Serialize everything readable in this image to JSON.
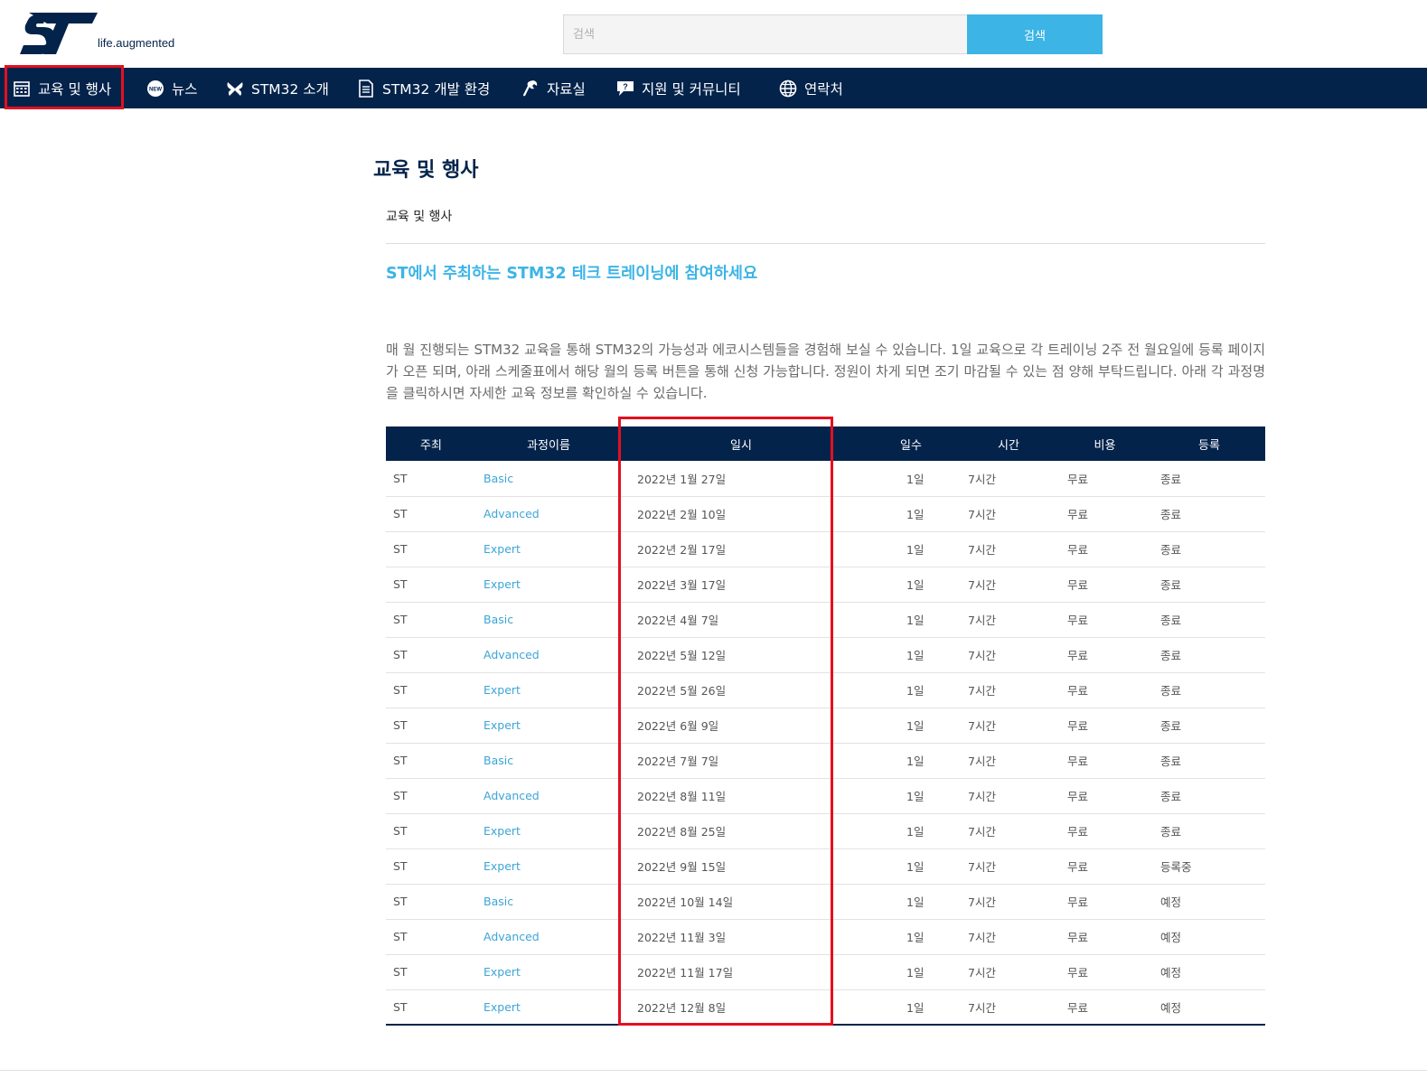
{
  "header": {
    "tagline": "life.augmented",
    "search_placeholder": "검색",
    "search_button": "검색",
    "brand_color": "#03234b",
    "accent_color": "#3cb4e6"
  },
  "nav": {
    "items": [
      {
        "label": "교육 및 행사",
        "icon": "calendar-icon"
      },
      {
        "label": "뉴스",
        "icon": "news-icon"
      },
      {
        "label": "STM32 소개",
        "icon": "butterfly-icon"
      },
      {
        "label": "STM32 개발 환경",
        "icon": "document-icon"
      },
      {
        "label": "자료실",
        "icon": "wrench-icon"
      },
      {
        "label": "지원 및 커뮤니티",
        "icon": "chat-question-icon"
      },
      {
        "label": "연락처",
        "icon": "globe-icon"
      }
    ]
  },
  "main": {
    "page_title": "교육 및 행사",
    "breadcrumb": "교육 및 행사",
    "subheading": "ST에서 주최하는 STM32 테크 트레이닝에 참여하세요",
    "intro": "매 월 진행되는 STM32 교육을 통해 STM32의 가능성과 에코시스템들을 경험해 보실 수 있습니다. 1일 교육으로 각 트레이닝 2주 전 월요일에 등록 페이지가 오픈 되며, 아래 스케줄표에서 해당 월의 등록 버튼을 통해 신청 가능합니다. 정원이 차게 되면 조기 마감될 수 있는 점 양해 부탁드립니다. 아래 각 과정명을 클릭하시면 자세한 교육 정보를 확인하실 수 있습니다."
  },
  "table": {
    "headers": [
      "주최",
      "과정이름",
      "일시",
      "일수",
      "시간",
      "비용",
      "등록"
    ],
    "rows": [
      [
        "ST",
        "Basic",
        "2022년 1월 27일",
        "1일",
        "7시간",
        "무료",
        "종료"
      ],
      [
        "ST",
        "Advanced",
        "2022년 2월 10일",
        "1일",
        "7시간",
        "무료",
        "종료"
      ],
      [
        "ST",
        "Expert",
        "2022년 2월 17일",
        "1일",
        "7시간",
        "무료",
        "종료"
      ],
      [
        "ST",
        "Expert",
        "2022년 3월 17일",
        "1일",
        "7시간",
        "무료",
        "종료"
      ],
      [
        "ST",
        "Basic",
        "2022년 4월 7일",
        "1일",
        "7시간",
        "무료",
        "종료"
      ],
      [
        "ST",
        "Advanced",
        "2022년 5월 12일",
        "1일",
        "7시간",
        "무료",
        "종료"
      ],
      [
        "ST",
        "Expert",
        "2022년 5월 26일",
        "1일",
        "7시간",
        "무료",
        "종료"
      ],
      [
        "ST",
        "Expert",
        "2022년 6월 9일",
        "1일",
        "7시간",
        "무료",
        "종료"
      ],
      [
        "ST",
        "Basic",
        "2022년 7월 7일",
        "1일",
        "7시간",
        "무료",
        "종료"
      ],
      [
        "ST",
        "Advanced",
        "2022년 8월 11일",
        "1일",
        "7시간",
        "무료",
        "종료"
      ],
      [
        "ST",
        "Expert",
        "2022년 8월 25일",
        "1일",
        "7시간",
        "무료",
        "종료"
      ],
      [
        "ST",
        "Expert",
        "2022년 9월 15일",
        "1일",
        "7시간",
        "무료",
        "등록중"
      ],
      [
        "ST",
        "Basic",
        "2022년 10월 14일",
        "1일",
        "7시간",
        "무료",
        "예정"
      ],
      [
        "ST",
        "Advanced",
        "2022년 11월 3일",
        "1일",
        "7시간",
        "무료",
        "예정"
      ],
      [
        "ST",
        "Expert",
        "2022년 11월 17일",
        "1일",
        "7시간",
        "무료",
        "예정"
      ],
      [
        "ST",
        "Expert",
        "2022년 12월 8일",
        "1일",
        "7시간",
        "무료",
        "예정"
      ]
    ]
  },
  "annotations": {
    "highlight_color": "#e3101f"
  }
}
